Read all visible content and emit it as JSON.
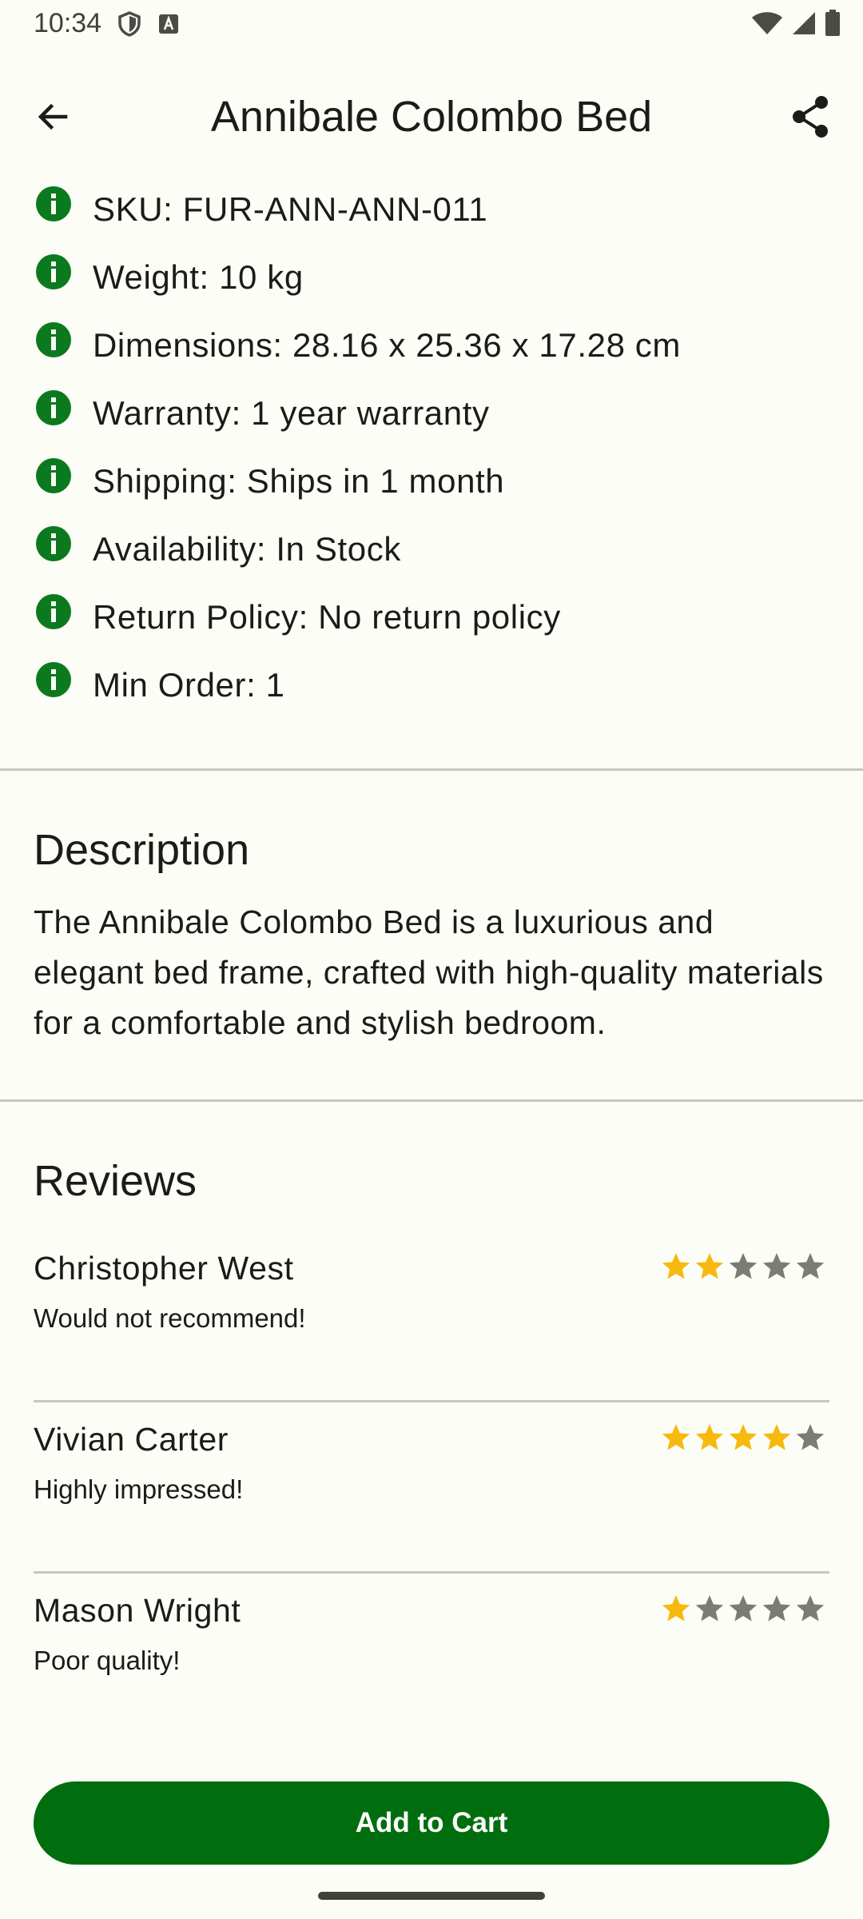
{
  "status_bar": {
    "time": "10:34",
    "icons_left": [
      "shield-icon",
      "keyboard-a-icon"
    ],
    "icons_right": [
      "wifi-icon",
      "signal-icon",
      "battery-icon"
    ]
  },
  "app_bar": {
    "title": "Annibale Colombo Bed",
    "back_icon": "arrow-back-icon",
    "share_icon": "share-icon"
  },
  "specs": [
    {
      "text": "SKU: FUR-ANN-ANN-011"
    },
    {
      "text": "Weight: 10 kg"
    },
    {
      "text": "Dimensions: 28.16 x 25.36 x 17.28 cm"
    },
    {
      "text": "Warranty: 1 year warranty"
    },
    {
      "text": "Shipping: Ships in 1 month"
    },
    {
      "text": "Availability: In Stock"
    },
    {
      "text": "Return Policy: No return policy"
    },
    {
      "text": "Min Order: 1"
    }
  ],
  "description": {
    "title": "Description",
    "text": "The Annibale Colombo Bed is a luxurious and elegant bed frame, crafted with high-quality materials for a comfortable and stylish bedroom."
  },
  "reviews": {
    "title": "Reviews",
    "items": [
      {
        "name": "Christopher West",
        "comment": "Would not recommend!",
        "rating": 2
      },
      {
        "name": "Vivian Carter",
        "comment": "Highly impressed!",
        "rating": 4
      },
      {
        "name": "Mason Wright",
        "comment": "Poor quality!",
        "rating": 1
      }
    ],
    "max_rating": 5
  },
  "actions": {
    "add_to_cart": "Add to Cart"
  },
  "colors": {
    "accent": "#006e0f",
    "info_icon": "#0b7a1e",
    "star_filled": "#f7b90f",
    "star_empty": "#7b7c76",
    "background": "#fcfdf6"
  }
}
